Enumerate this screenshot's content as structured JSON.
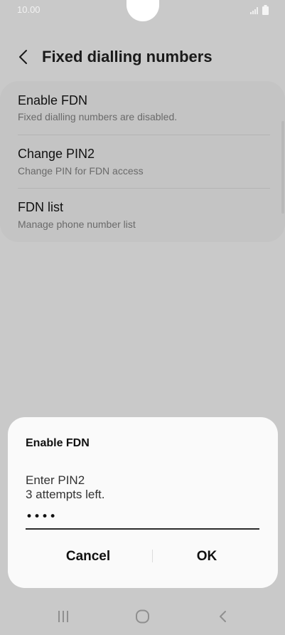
{
  "status_bar": {
    "time": "10.00"
  },
  "header": {
    "title": "Fixed dialling numbers"
  },
  "settings": {
    "items": [
      {
        "title": "Enable FDN",
        "subtitle": "Fixed dialling numbers are disabled."
      },
      {
        "title": "Change PIN2",
        "subtitle": "Change PIN for FDN access"
      },
      {
        "title": "FDN list",
        "subtitle": "Manage phone number list"
      }
    ]
  },
  "dialog": {
    "title": "Enable FDN",
    "message_line1": "Enter PIN2",
    "message_line2": "3 attempts left.",
    "pin_value": "••••",
    "cancel_label": "Cancel",
    "ok_label": "OK"
  },
  "nav_bar": {
    "icons": [
      "recent-apps-icon",
      "home-icon",
      "back-icon"
    ]
  },
  "colors": {
    "background_dim": "#c9c9c9",
    "dialog_bg": "#fafafa",
    "text_primary": "#111111",
    "text_secondary": "#6a6a6a"
  }
}
